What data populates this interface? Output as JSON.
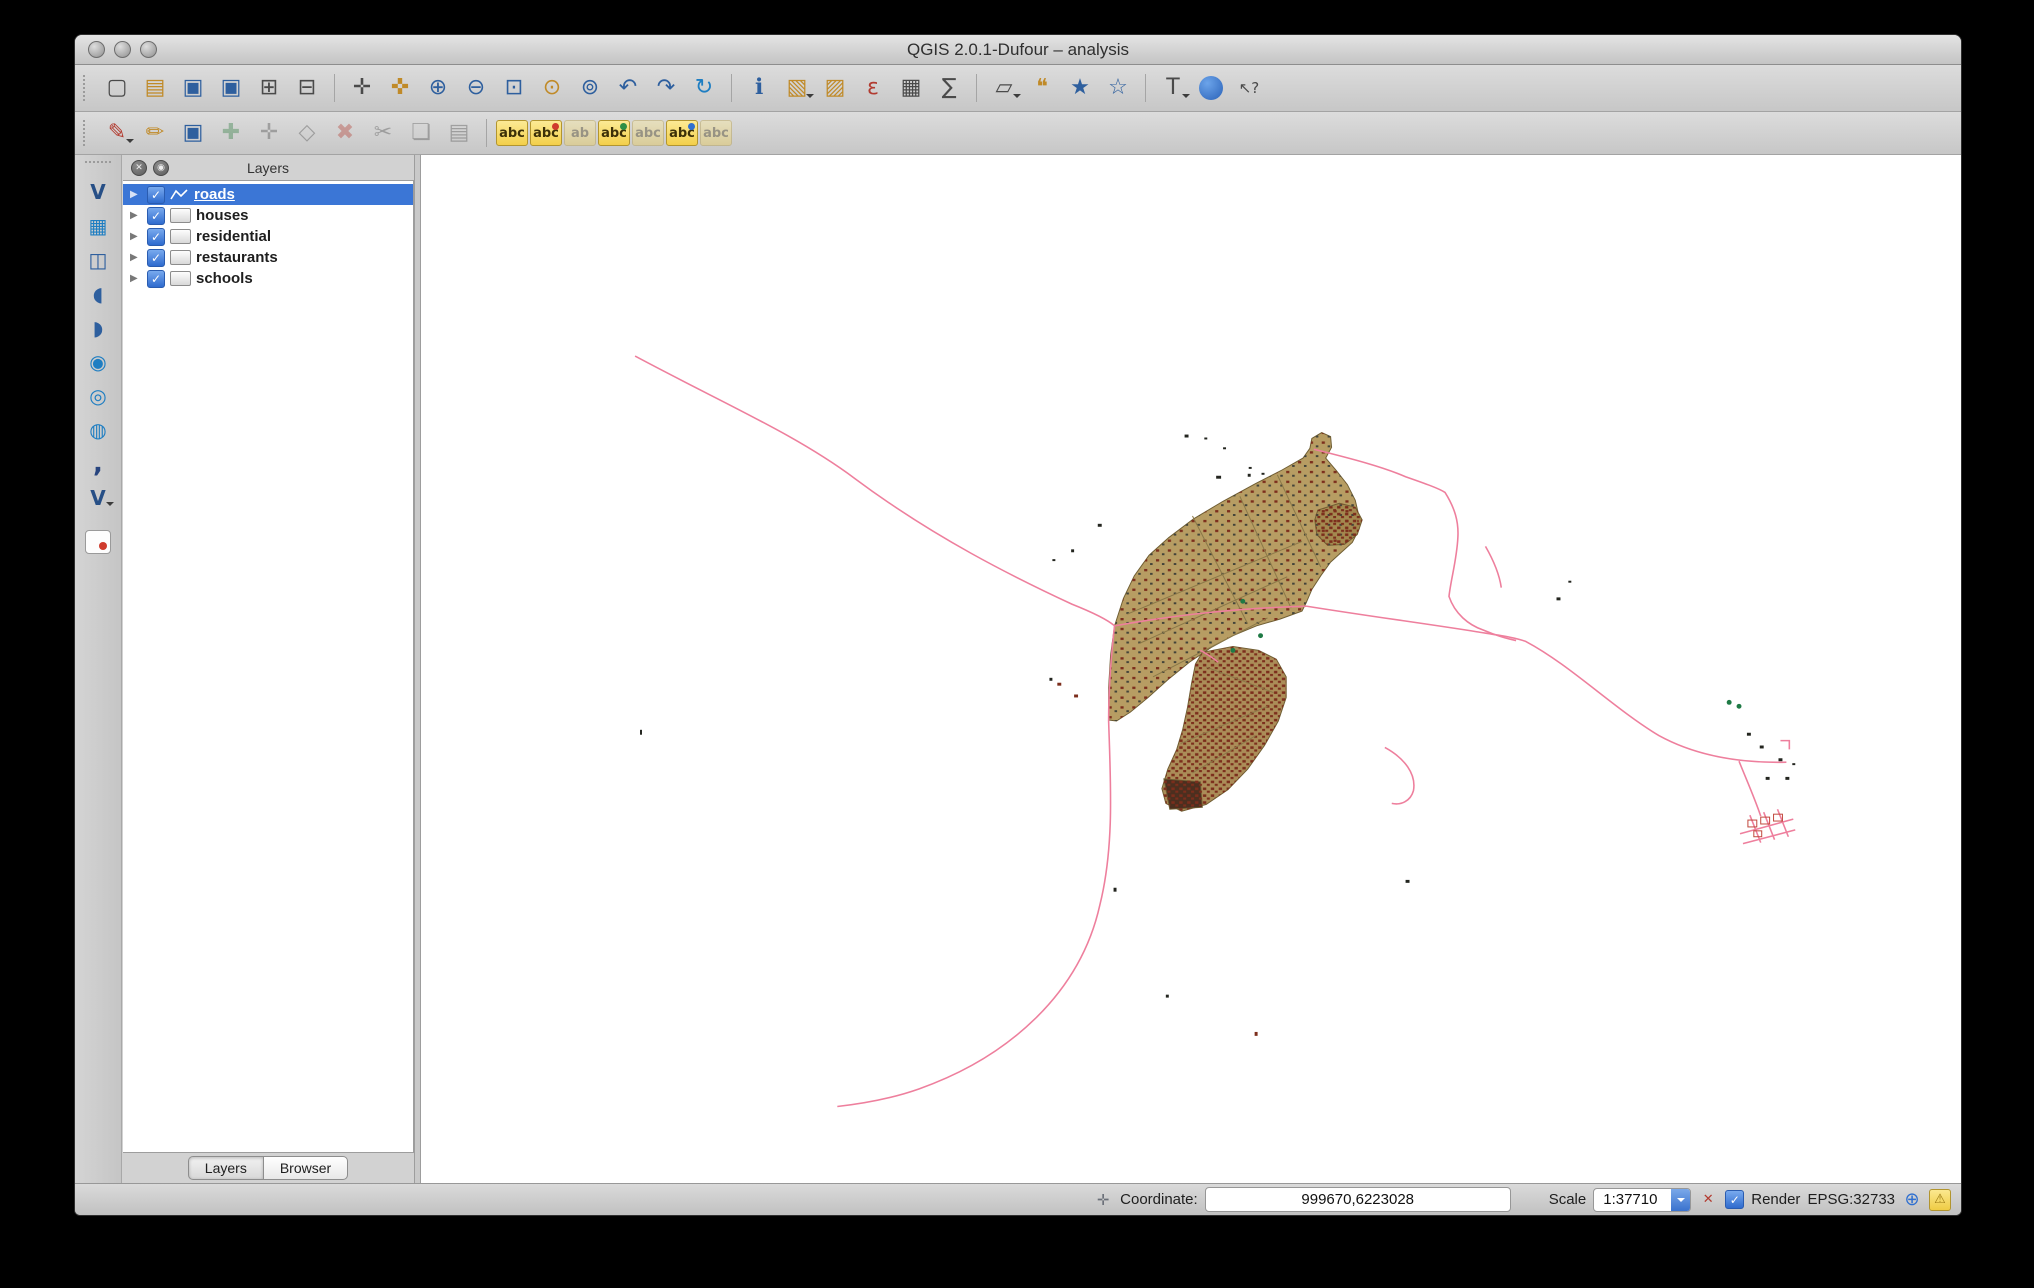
{
  "window": {
    "title": "QGIS 2.0.1-Dufour – analysis"
  },
  "icons": {
    "expand": "▶",
    "check": "✓",
    "close": "✕",
    "float": "◉",
    "warning": "⚠",
    "crs": "⊕",
    "stop": "✕",
    "mouse": "✛"
  },
  "toolbars": {
    "main": [
      {
        "name": "new-project",
        "glyph": "▢"
      },
      {
        "name": "open-project",
        "glyph": "▤"
      },
      {
        "name": "save-project",
        "glyph": "▣"
      },
      {
        "name": "save-project-as",
        "glyph": "▣"
      },
      {
        "name": "new-print-composer",
        "glyph": "⊞"
      },
      {
        "name": "composer-manager",
        "glyph": "⊟"
      },
      {
        "name": "pan-map",
        "glyph": "✛"
      },
      {
        "name": "pan-to-selection",
        "glyph": "✜"
      },
      {
        "name": "zoom-in",
        "glyph": "⊕"
      },
      {
        "name": "zoom-out",
        "glyph": "⊖"
      },
      {
        "name": "zoom-full",
        "glyph": "⊡"
      },
      {
        "name": "zoom-to-selection",
        "glyph": "⊙"
      },
      {
        "name": "zoom-to-layer",
        "glyph": "⊚"
      },
      {
        "name": "zoom-last",
        "glyph": "↶"
      },
      {
        "name": "zoom-next",
        "glyph": "↷"
      },
      {
        "name": "refresh-map",
        "glyph": "↻"
      },
      {
        "name": "identify-features",
        "glyph": "ℹ"
      },
      {
        "name": "select-features",
        "glyph": "▧"
      },
      {
        "name": "deselect-features",
        "glyph": "▨"
      },
      {
        "name": "select-by-expression",
        "glyph": "ε"
      },
      {
        "name": "open-attribute-table",
        "glyph": "▦"
      },
      {
        "name": "field-calculator",
        "glyph": "∑"
      },
      {
        "name": "measure-line",
        "glyph": "▱"
      },
      {
        "name": "map-tips",
        "glyph": "❝"
      },
      {
        "name": "new-bookmark",
        "glyph": "★"
      },
      {
        "name": "show-bookmarks",
        "glyph": "☆"
      },
      {
        "name": "text-annotation",
        "glyph": "T"
      },
      {
        "name": "help-contents",
        "glyph": "?"
      },
      {
        "name": "whats-this",
        "glyph": "↖?"
      }
    ],
    "edit": [
      {
        "name": "current-edits",
        "glyph": "✎"
      },
      {
        "name": "toggle-editing",
        "glyph": "✏"
      },
      {
        "name": "save-layer-edits",
        "glyph": "▣"
      },
      {
        "name": "add-feature",
        "glyph": "✚"
      },
      {
        "name": "move-feature",
        "glyph": "✛"
      },
      {
        "name": "node-tool",
        "glyph": "◇"
      },
      {
        "name": "delete-selected",
        "glyph": "✖"
      },
      {
        "name": "cut-features",
        "glyph": "✂"
      },
      {
        "name": "copy-features",
        "glyph": "❏"
      },
      {
        "name": "paste-features",
        "glyph": "▤"
      },
      {
        "name": "layer-labeling",
        "glyph": "abc"
      },
      {
        "name": "show-hide-labels",
        "glyph": "abc"
      },
      {
        "name": "pin-unpin-labels",
        "glyph": "ab"
      },
      {
        "name": "highlight-pinned-labels",
        "glyph": "abc"
      },
      {
        "name": "move-label",
        "glyph": "abc"
      },
      {
        "name": "rotate-label",
        "glyph": "abc"
      },
      {
        "name": "change-label-properties",
        "glyph": "abc"
      }
    ],
    "left": [
      {
        "name": "add-vector-layer",
        "glyph": "V"
      },
      {
        "name": "add-raster-layer",
        "glyph": "▦"
      },
      {
        "name": "add-postgis-layer",
        "glyph": "◫"
      },
      {
        "name": "add-spatialite-layer",
        "glyph": "◖"
      },
      {
        "name": "add-mssql-layer",
        "glyph": "◗"
      },
      {
        "name": "add-wms-layer",
        "glyph": "◉"
      },
      {
        "name": "add-wcs-layer",
        "glyph": "◎"
      },
      {
        "name": "add-wfs-layer",
        "glyph": "◍"
      },
      {
        "name": "add-delimited-text-layer",
        "glyph": ","
      },
      {
        "name": "new-shapefile-layer",
        "glyph": "V"
      },
      {
        "name": "remove-layer",
        "glyph": ""
      }
    ]
  },
  "layers_panel": {
    "title": "Layers",
    "layers": [
      {
        "label": "roads",
        "checked": true,
        "selected": true
      },
      {
        "label": "houses",
        "checked": true,
        "selected": false
      },
      {
        "label": "residential",
        "checked": true,
        "selected": false
      },
      {
        "label": "restaurants",
        "checked": true,
        "selected": false
      },
      {
        "label": "schools",
        "checked": true,
        "selected": false
      }
    ],
    "tabs": [
      {
        "label": "Layers",
        "active": true
      },
      {
        "label": "Browser",
        "active": false
      }
    ]
  },
  "status_bar": {
    "coordinate_label": "Coordinate:",
    "coordinate_value": "999670,6223028",
    "scale_label": "Scale",
    "scale_value": "1:37710",
    "render_label": "Render",
    "render_checked": true,
    "epsg_label": "EPSG:32733"
  },
  "map": {
    "background": "#ffffff",
    "road_color": "#ee7f9d",
    "town_fill": "#b79d63",
    "town_stroke": "#6f5e33",
    "lobe_fill": "#a3894f",
    "south_fill": "#ab8d58",
    "dark_block_fill": "#4c2f1f",
    "building_color": "#7c2e1c",
    "building_alt_color": "#43443a",
    "street_color": "#8a7848",
    "mark_color": "#23251f",
    "green_mark_color": "#1f7a45",
    "settlement_stroke": "#c0453a"
  }
}
